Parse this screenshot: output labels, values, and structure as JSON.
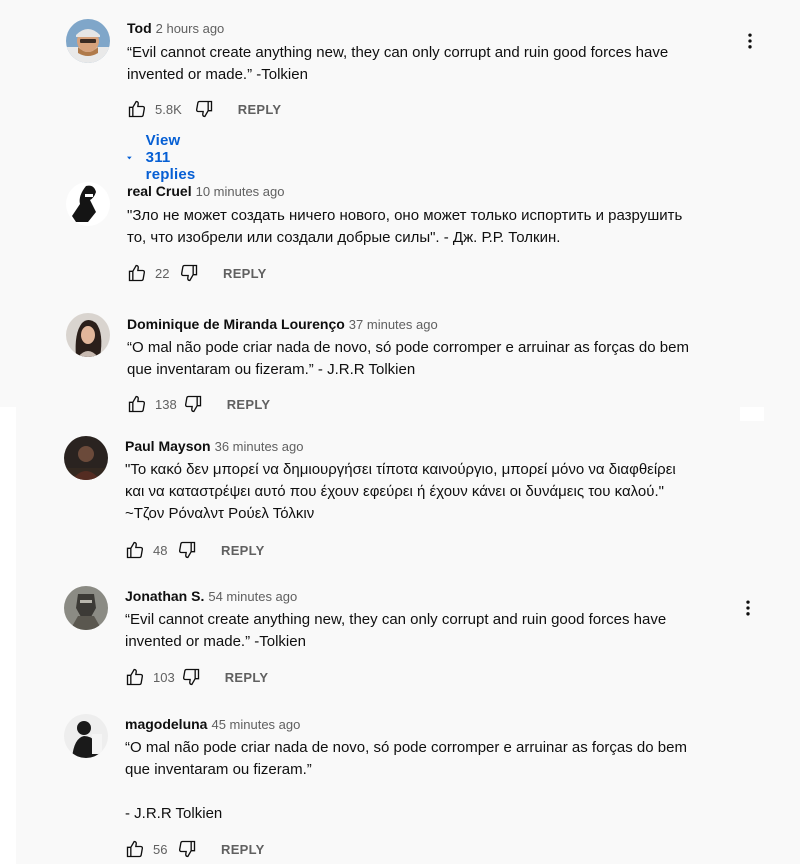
{
  "comments": [
    {
      "author": "Tod",
      "time": "2 hours ago",
      "text": "“Evil cannot create anything new, they can only corrupt and ruin good forces have\ninvented or made.” -Tolkien",
      "likes": "5.8K",
      "reply_label": "REPLY",
      "view_replies": "View 311 replies",
      "avatar_icon": "avatar-man-cap-icon"
    },
    {
      "author": "real Cruel",
      "time": "10 minutes ago",
      "text": "\"Зло не может создать ничего нового, оно может только испортить и разрушить\nто, что изобрели или создали добрые силы\". - Дж. Р.Р. Толкин.",
      "likes": "22",
      "reply_label": "REPLY",
      "avatar_icon": "avatar-figure-icon"
    },
    {
      "author": "Dominique de Miranda Lourenço",
      "time": "37 minutes ago",
      "text": "“O mal não pode criar nada de novo, só pode corromper e arruinar as forças do bem\nque inventaram ou fizeram.” - J.R.R Tolkien",
      "likes": "138",
      "reply_label": "REPLY",
      "avatar_icon": "avatar-woman-icon"
    },
    {
      "author": "Paul Mayson",
      "time": "36 minutes ago",
      "text": "\"Το κακό δεν μπορεί να δημιουργήσει τίποτα καινούργιο, μπορεί μόνο να διαφθείρει\nκαι να καταστρέψει αυτό που έχουν εφεύρει ή έχουν κάνει οι δυνάμεις του καλού.\"\n~Τζον Ρόναλντ Ρούελ Τόλκιν",
      "likes": "48",
      "reply_label": "REPLY",
      "avatar_icon": "avatar-dark-scene-icon"
    },
    {
      "author": "Jonathan S.",
      "time": "54 minutes ago",
      "text": "“Evil cannot create anything new, they can only corrupt and ruin good forces have\ninvented or made.” -Tolkien",
      "likes": "103",
      "reply_label": "REPLY",
      "avatar_icon": "avatar-knight-icon"
    },
    {
      "author": "magodeluna",
      "time": "45 minutes ago",
      "text": "“O mal não pode criar nada de novo, só pode corromper e arruinar as forças do bem\nque inventaram ou fizeram.”\n\n- J.R.R Tolkien",
      "likes": "56",
      "reply_label": "REPLY",
      "avatar_icon": "avatar-silhouette-icon"
    }
  ],
  "colors": {
    "background": "#f9f9f9",
    "link_blue": "#065fd4",
    "muted": "#606060"
  }
}
